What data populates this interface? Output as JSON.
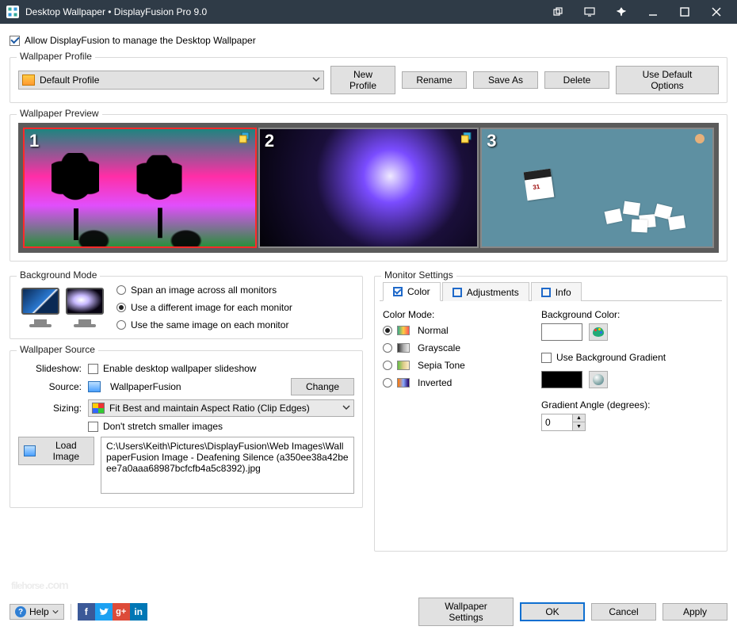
{
  "window": {
    "title": "Desktop Wallpaper • DisplayFusion Pro 9.0"
  },
  "allow_manage": {
    "label": "Allow DisplayFusion to manage the Desktop Wallpaper",
    "checked": true
  },
  "profile": {
    "legend": "Wallpaper Profile",
    "selected": "Default Profile",
    "buttons": {
      "new": "New Profile",
      "rename": "Rename",
      "saveas": "Save As",
      "delete": "Delete",
      "defaults": "Use Default Options"
    }
  },
  "preview": {
    "legend": "Wallpaper Preview",
    "monitors": [
      {
        "num": "1",
        "selected": true
      },
      {
        "num": "2",
        "selected": false
      },
      {
        "num": "3",
        "selected": false
      }
    ]
  },
  "bg_mode": {
    "legend": "Background Mode",
    "options": {
      "span": "Span an image across all monitors",
      "diff": "Use a different image for each monitor",
      "same": "Use the same image on each monitor"
    },
    "selected": "diff"
  },
  "source": {
    "legend": "Wallpaper Source",
    "labels": {
      "slideshow": "Slideshow:",
      "source": "Source:",
      "sizing": "Sizing:"
    },
    "slideshow": {
      "label": "Enable desktop wallpaper slideshow",
      "checked": false
    },
    "provider": "WallpaperFusion",
    "change_btn": "Change",
    "sizing": "Fit Best and maintain Aspect Ratio (Clip Edges)",
    "no_stretch": {
      "label": "Don't stretch smaller images",
      "checked": false
    },
    "load_btn": "Load Image",
    "path": "C:\\Users\\Keith\\Pictures\\DisplayFusion\\Web Images\\WallpaperFusion Image - Deafening Silence (a350ee38a42beee7a0aaa68987bcfcfb4a5c8392).jpg"
  },
  "monitor_settings": {
    "legend": "Monitor Settings",
    "tabs": {
      "color": "Color",
      "adjustments": "Adjustments",
      "info": "Info"
    },
    "active_tab": "color",
    "color": {
      "mode_label": "Color Mode:",
      "modes": {
        "normal": "Normal",
        "grayscale": "Grayscale",
        "sepia": "Sepia Tone",
        "inverted": "Inverted"
      },
      "selected_mode": "normal",
      "bg_color_label": "Background Color:",
      "use_gradient": {
        "label": "Use Background Gradient",
        "checked": false
      },
      "angle_label": "Gradient Angle (degrees):",
      "angle_value": "0"
    }
  },
  "footer": {
    "help": "Help",
    "wallpaper_settings": "Wallpaper Settings",
    "ok": "OK",
    "cancel": "Cancel",
    "apply": "Apply"
  },
  "watermark": "filehorse",
  "watermark_tld": ".com"
}
